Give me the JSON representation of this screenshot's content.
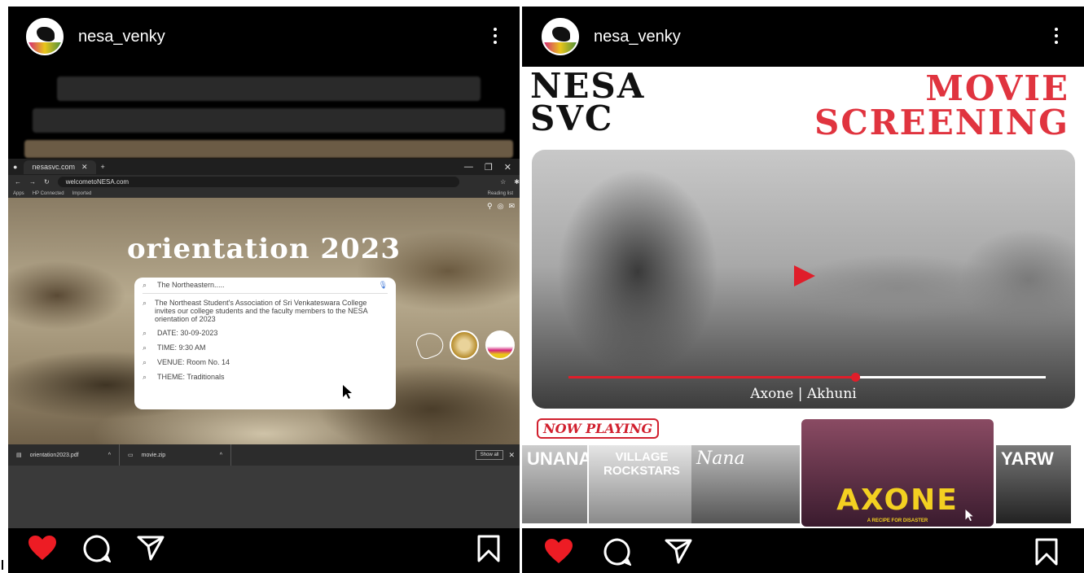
{
  "posts": [
    {
      "username": "nesa_venky",
      "browser": {
        "tab_title": "nesasvc.com",
        "url": "welcometoNESA.com",
        "bookmarks": [
          "Apps",
          "HP Connected",
          "Imported"
        ],
        "reading_list": "Reading list",
        "headline": "orientation 2023",
        "search": {
          "query": "The Northeastern.....",
          "suggestions": [
            "The Northeast Student's Association of Sri Venkateswara College invites our college students and the faculty members to the NESA orientation of 2023",
            "DATE: 30-09-2023",
            "TIME: 9:30 AM",
            "VENUE: Room No. 14",
            "THEME: Traditionals"
          ]
        },
        "downloads": [
          "orientation2023.pdf",
          "movie.zip"
        ],
        "show_all": "Show all"
      }
    },
    {
      "username": "nesa_venky",
      "poster": {
        "left_title": [
          "NESA",
          "SVC"
        ],
        "right_title": [
          "MOVIE",
          "SCREENING"
        ],
        "video_title": "Axone | Akhuni",
        "progress": 0.6,
        "now_playing": "NOW PLAYING",
        "thumbnails": [
          "UNANA",
          "VILLAGE ROCKSTARS",
          "Nana",
          "AXONE",
          "YARW"
        ],
        "axone_tagline": "A RECIPE FOR DISASTER"
      }
    }
  ],
  "colors": {
    "heart": "#ed1c24",
    "accent_red": "#e0343f",
    "axone_yellow": "#f3d021"
  },
  "icons": [
    "heart-icon",
    "comment-icon",
    "share-icon",
    "bookmark-icon",
    "more-options-icon",
    "play-icon",
    "cursor-icon"
  ]
}
